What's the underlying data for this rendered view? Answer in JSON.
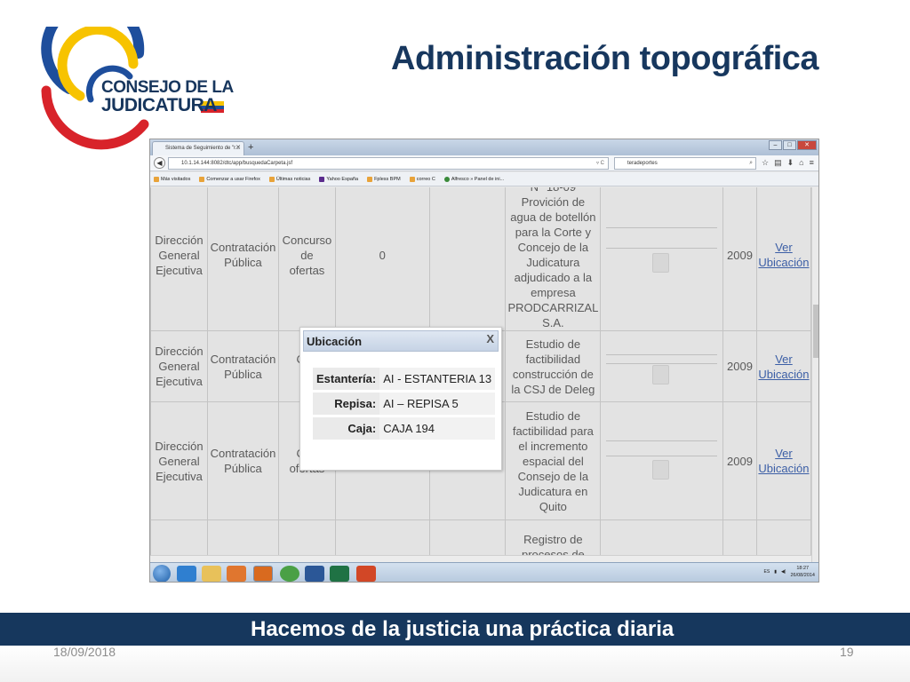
{
  "slide": {
    "title": "Administración topográfica",
    "date": "18/09/2018",
    "page_number": "19",
    "footer_slogan": "Hacemos de la justicia una práctica diaria"
  },
  "logo": {
    "line1": "CONSEJO DE LA",
    "line2": "JUDICATURA",
    "colors": {
      "navy": "#17365d",
      "yellow": "#f7c300",
      "blue": "#1e4e9c",
      "red": "#d8232a"
    }
  },
  "browser": {
    "tab_title": "Sistema de Seguimiento de \"r...",
    "url": "10.1.14.144:8082/dtc/app/busquedaCarpeta.jsf",
    "search_text": "teradeportes",
    "bookmarks": [
      "Más visitados",
      "Comenzar a usar Firefox",
      "Últimas noticias",
      "Yahoo España",
      "Fpless BPM",
      "correo C",
      "Alfresco » Panel de ini..."
    ]
  },
  "table": {
    "link_line1": "Ver",
    "link_line2": "Ubicación",
    "rows": [
      {
        "direccion": [
          "Dirección",
          "General",
          "Ejecutiva"
        ],
        "tipo": [
          "Contratación",
          "Pública"
        ],
        "proceso": [
          "Concurso",
          "de",
          "ofertas"
        ],
        "numero": "0",
        "descripcion": [
          "N° 18-09",
          "Provición de",
          "agua de botellón",
          "para la Corte y",
          "Concejo de la",
          "Judicatura",
          "adjudicado a la",
          "empresa",
          "PRODCARRIZAL",
          "S.A."
        ],
        "anio": "2009"
      },
      {
        "direccion": [
          "Dirección",
          "General",
          "Ejecutiva"
        ],
        "tipo": [
          "Contratación",
          "Pública"
        ],
        "proceso": [
          "Con",
          "",
          "of"
        ],
        "numero": "",
        "descripcion": [
          "Estudio de",
          "factibilidad",
          "construcción de",
          "la CSJ de Deleg"
        ],
        "anio": "2009"
      },
      {
        "direccion": [
          "Dirección",
          "General",
          "Ejecutiva"
        ],
        "tipo": [
          "Contratación",
          "Pública"
        ],
        "proceso": [
          "Con",
          "",
          "ofertas"
        ],
        "numero": "",
        "descripcion": [
          "Estudio de",
          "factibilidad para",
          "el incremento",
          "espacial del",
          "Consejo de la",
          "Judicatura en",
          "Quito"
        ],
        "anio": "2009"
      },
      {
        "direccion": [
          "",
          "",
          ""
        ],
        "tipo": [
          "",
          ""
        ],
        "proceso": [
          "",
          "",
          ""
        ],
        "numero": "",
        "descripcion": [
          "Registro de",
          "procesos de"
        ],
        "anio": ""
      }
    ]
  },
  "dialog": {
    "title": "Ubicación",
    "close": "X",
    "fields": [
      {
        "label": "Estantería:",
        "value": "AI - ESTANTERIA 13"
      },
      {
        "label": "Repisa:",
        "value": "AI – REPISA 5"
      },
      {
        "label": "Caja:",
        "value": "CAJA 194"
      }
    ]
  },
  "taskbar": {
    "clock_time": "18:27",
    "clock_date": "26/08/2014",
    "language": "ES"
  }
}
